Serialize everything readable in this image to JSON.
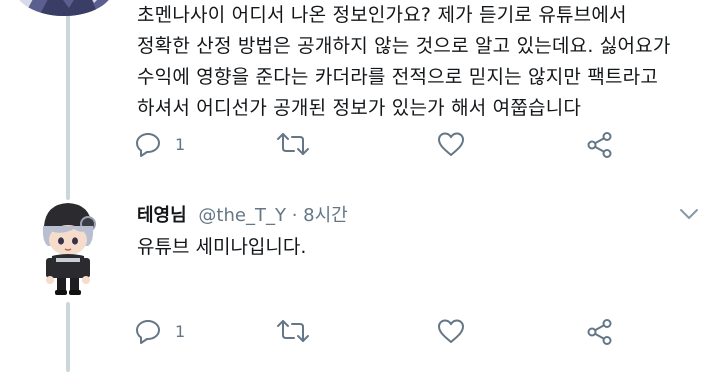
{
  "tweet_prev": {
    "lines": [
      "초멘나사이 어디서 나온 정보인가요? 제가 듣기로 유튜브에서",
      "정확한 산정 방법은 공개하지 않는 것으로 알고 있는데요. 싫어요가",
      "수익에 영향을 준다는 카더라를 전적으로 믿지는 않지만 팩트라고",
      "하셔서 어디선가 공개된 정보가 있는가 해서 여쭙습니다"
    ],
    "actions": {
      "reply_count": "1"
    }
  },
  "tweet_reply": {
    "display_name": "테영님",
    "handle": "@the_T_Y",
    "separator": "·",
    "time": "8시간",
    "text": "유튜브 세미나입니다.",
    "actions": {
      "reply_count": "1"
    }
  },
  "icons": [
    "reply-icon",
    "retweet-icon",
    "like-icon",
    "share-icon",
    "chevron-down-icon"
  ],
  "colors": {
    "icon_gray": "#657786",
    "thread_line": "#ccd6dd",
    "text": "#14171a"
  }
}
